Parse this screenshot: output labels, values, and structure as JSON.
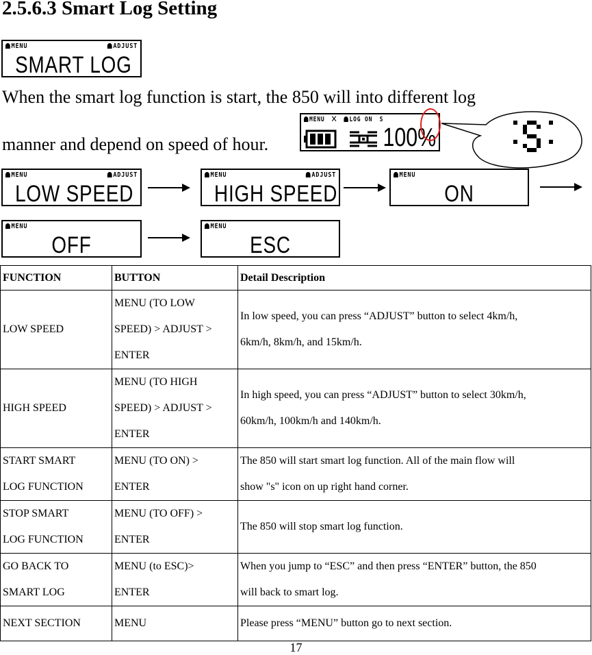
{
  "heading": "2.5.6.3 Smart Log Setting",
  "intro": {
    "line1": "When the smart log function is start, the 850 will into different log",
    "line2": "manner and depend on speed of hour."
  },
  "lcd_common": {
    "menu_label": "MENU",
    "adjust_label": "ADJUST"
  },
  "smart_log_screen": {
    "main": "SMART LOG"
  },
  "status_screen": {
    "menu_label": "MENU",
    "log_label": "LOG ON",
    "s_indicator": "S",
    "percent": "100%",
    "battery_icon": "battery-full-icon",
    "bike_icon": "bicycle-icon",
    "callout_glyph": "S",
    "highlight_color": "#e02020"
  },
  "flow_screens": [
    {
      "main": "LOW SPEED",
      "show_adjust": true
    },
    {
      "main": "HIGH SPEED",
      "show_adjust": true
    },
    {
      "main": "ON",
      "show_adjust": false
    },
    {
      "main": "OFF",
      "show_adjust": false
    },
    {
      "main": "ESC",
      "show_adjust": false
    }
  ],
  "table": {
    "headers": [
      "FUNCTION",
      "BUTTON",
      "Detail Description"
    ],
    "rows": [
      {
        "function": [
          "LOW SPEED"
        ],
        "button": [
          "MENU (TO LOW",
          "SPEED) > ADJUST >",
          "ENTER"
        ],
        "detail": [
          "In low speed, you can press “ADJUST” button to select 4km/h,",
          "6km/h, 8km/h, and 15km/h."
        ]
      },
      {
        "function": [
          "HIGH SPEED"
        ],
        "button": [
          "MENU (TO HIGH",
          "SPEED) > ADJUST >",
          "ENTER"
        ],
        "detail": [
          "In high speed, you can press “ADJUST” button to select 30km/h,",
          "60km/h, 100km/h and 140km/h."
        ]
      },
      {
        "function": [
          "START SMART",
          "LOG FUNCTION"
        ],
        "button": [
          "MENU (TO ON) >",
          "ENTER"
        ],
        "detail": [
          "The 850 will start smart log function. All of the main flow will",
          "show \"s\" icon on up right hand corner."
        ]
      },
      {
        "function": [
          "STOP SMART",
          "LOG FUNCTION"
        ],
        "button": [
          "MENU (TO OFF) >",
          "ENTER"
        ],
        "detail": [
          "The 850 will stop smart log function."
        ]
      },
      {
        "function": [
          "GO BACK TO",
          "SMART LOG"
        ],
        "button": [
          "MENU (to ESC)>",
          "ENTER"
        ],
        "detail": [
          "When you jump to “ESC” and then press “ENTER” button, the 850",
          "will back to smart log."
        ]
      },
      {
        "function": [
          "NEXT SECTION"
        ],
        "button": [
          "MENU"
        ],
        "detail": [
          "Please press “MENU” button go to next section."
        ]
      }
    ]
  },
  "page_number": "17"
}
